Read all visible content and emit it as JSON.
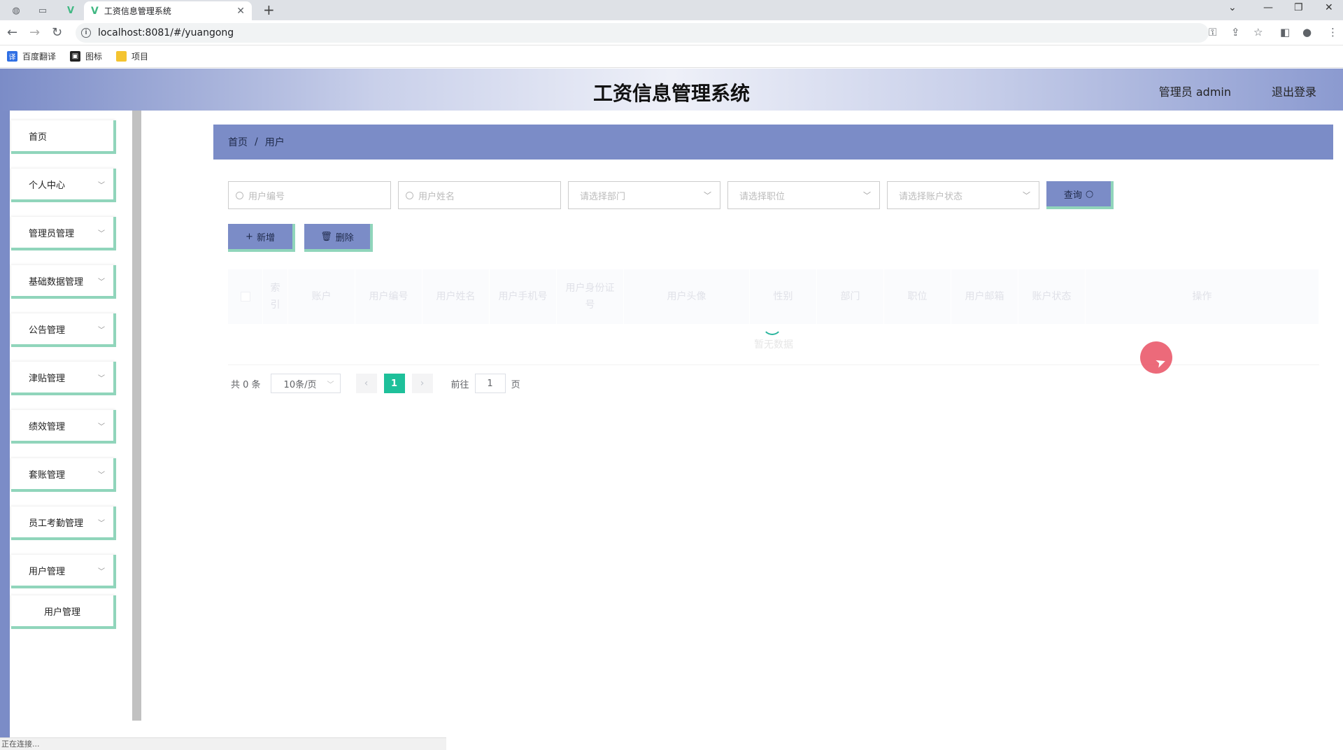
{
  "browser": {
    "tab_title": "工资信息管理系统",
    "url": "localhost:8081/#/yuangong",
    "bookmarks": [
      "百度翻译",
      "图标",
      "项目"
    ],
    "status_text": "正在连接..."
  },
  "header": {
    "title": "工资信息管理系统",
    "user_label": "管理员 admin",
    "logout_label": "退出登录"
  },
  "sidebar": {
    "items": [
      {
        "label": "首页"
      },
      {
        "label": "个人中心"
      },
      {
        "label": "管理员管理"
      },
      {
        "label": "基础数据管理"
      },
      {
        "label": "公告管理"
      },
      {
        "label": "津贴管理"
      },
      {
        "label": "绩效管理"
      },
      {
        "label": "套账管理"
      },
      {
        "label": "员工考勤管理"
      },
      {
        "label": "用户管理"
      },
      {
        "label": "用户管理"
      }
    ]
  },
  "breadcrumb": {
    "home": "首页",
    "separator": "/",
    "current": "用户"
  },
  "search": {
    "user_no_placeholder": "用户编号",
    "user_name_placeholder": "用户姓名",
    "dept_placeholder": "请选择部门",
    "position_placeholder": "请选择职位",
    "status_placeholder": "请选择账户状态",
    "query_label": "查询"
  },
  "actions": {
    "add_label": "新增",
    "delete_label": "删除"
  },
  "table": {
    "columns": [
      "索引",
      "账户",
      "用户编号",
      "用户姓名",
      "用户手机号",
      "用户身份证号",
      "用户头像",
      "性别",
      "部门",
      "职位",
      "用户邮箱",
      "账户状态",
      "操作"
    ],
    "empty_text": "暂无数据"
  },
  "pagination": {
    "total_text": "共 0 条",
    "page_size": "10条/页",
    "current_page": "1",
    "goto_prefix": "前往",
    "goto_value": "1",
    "goto_suffix": "页"
  },
  "colors": {
    "accent": "#7b8cc7",
    "border_accent": "#90d5bb",
    "active_page": "#1ec09a"
  }
}
